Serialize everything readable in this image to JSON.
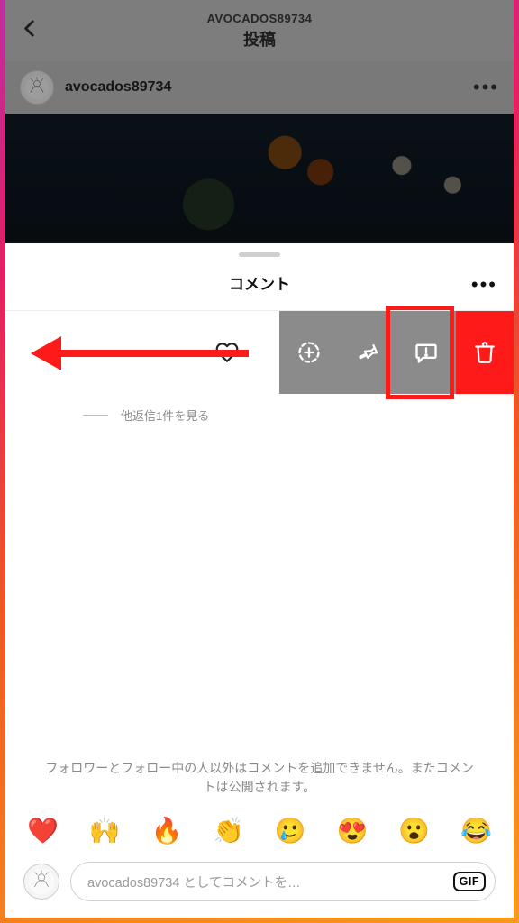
{
  "header": {
    "account_caps": "AVOCADOS89734",
    "page_title": "投稿"
  },
  "post": {
    "username": "avocados89734"
  },
  "sheet": {
    "title": "コメント",
    "view_replies": "他返信1件を見る",
    "notice": "フォロワーとフォロー中の人以外はコメントを追加できません。またコメントは公開されます。",
    "input_placeholder": "avocados89734 としてコメントを…",
    "gif_label": "GIF"
  },
  "emojis": [
    "❤️",
    "🙌",
    "🔥",
    "👏",
    "🥲",
    "😍",
    "😮",
    "😂"
  ],
  "icons": {
    "back": "chevron-left",
    "more": "more-horizontal",
    "heart": "heart-outline",
    "restrict": "plus-circle-dashed",
    "pin": "pin",
    "report": "message-alert",
    "delete": "trash"
  },
  "colors": {
    "accent_red": "#ff1a1a",
    "swipe_gray": "#8b8b8b"
  }
}
